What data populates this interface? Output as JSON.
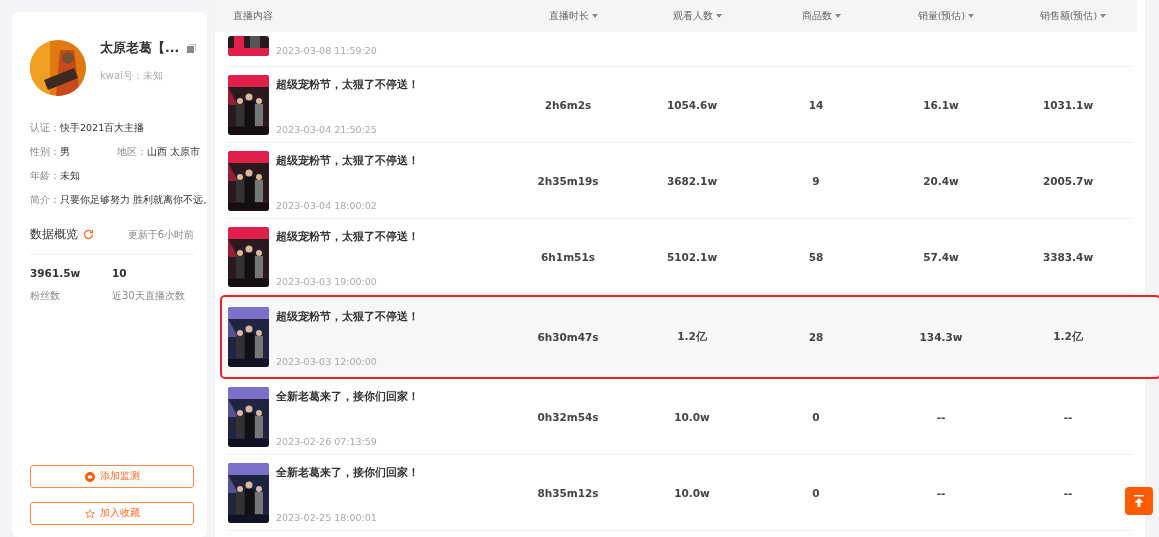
{
  "profile": {
    "name": "太原老葛【...",
    "kwai_id": "kwai号：未知",
    "fields": [
      {
        "label": "认证：",
        "value": "快手2021百大主播"
      },
      {
        "label": "性别：",
        "value": "男"
      },
      {
        "label": "地区：",
        "value": "山西 太原市"
      },
      {
        "label": "年龄：",
        "value": "未知"
      },
      {
        "label": "简介：",
        "value": "只要你足够努力 胜利就离你不远。"
      }
    ]
  },
  "overview": {
    "title": "数据概览",
    "updated": "更新于6小时前",
    "stats": [
      {
        "value": "3961.5w",
        "label": "粉丝数"
      },
      {
        "value": "10",
        "label": "近30天直播次数"
      }
    ]
  },
  "actions": [
    {
      "kind": "monitor",
      "label": "添加监测"
    },
    {
      "kind": "favorite",
      "label": "加入收藏"
    }
  ],
  "table": {
    "columns": [
      {
        "label": "直播内容",
        "sortable": false
      },
      {
        "label": "直播时长",
        "sortable": true
      },
      {
        "label": "观看人数",
        "sortable": true
      },
      {
        "label": "商品数",
        "sortable": true
      },
      {
        "label": "销量(预估)",
        "sortable": true
      },
      {
        "label": "销售额(预估)",
        "sortable": true
      }
    ],
    "rows": [
      {
        "partial": true,
        "highlighted": false,
        "date": "2023-03-08 11:59:20"
      },
      {
        "partial": false,
        "highlighted": false,
        "title": "超级宠粉节，太狠了不停送！",
        "date": "2023-03-04 21:50:25",
        "cells": [
          "2h6m2s",
          "1054.6w",
          "14",
          "16.1w",
          "1031.1w"
        ]
      },
      {
        "partial": false,
        "highlighted": false,
        "title": "超级宠粉节，太狠了不停送！",
        "date": "2023-03-04 18:00:02",
        "cells": [
          "2h35m19s",
          "3682.1w",
          "9",
          "20.4w",
          "2005.7w"
        ]
      },
      {
        "partial": false,
        "highlighted": false,
        "title": "超级宠粉节，太狠了不停送！",
        "date": "2023-03-03 19:00:00",
        "cells": [
          "6h1m51s",
          "5102.1w",
          "58",
          "57.4w",
          "3383.4w"
        ]
      },
      {
        "partial": false,
        "highlighted": true,
        "title": "超级宠粉节，太狠了不停送！",
        "date": "2023-03-03 12:00:00",
        "cells": [
          "6h30m47s",
          "1.2亿",
          "28",
          "134.3w",
          "1.2亿"
        ]
      },
      {
        "partial": false,
        "highlighted": false,
        "title": "全新老葛来了，接你们回家！",
        "date": "2023-02-26 07:13:59",
        "cells": [
          "0h32m54s",
          "10.0w",
          "0",
          "--",
          "--"
        ]
      },
      {
        "partial": false,
        "highlighted": false,
        "title": "全新老葛来了，接你们回家！",
        "date": "2023-02-25 18:00:01",
        "cells": [
          "8h35m12s",
          "10.0w",
          "0",
          "--",
          "--"
        ]
      }
    ]
  }
}
